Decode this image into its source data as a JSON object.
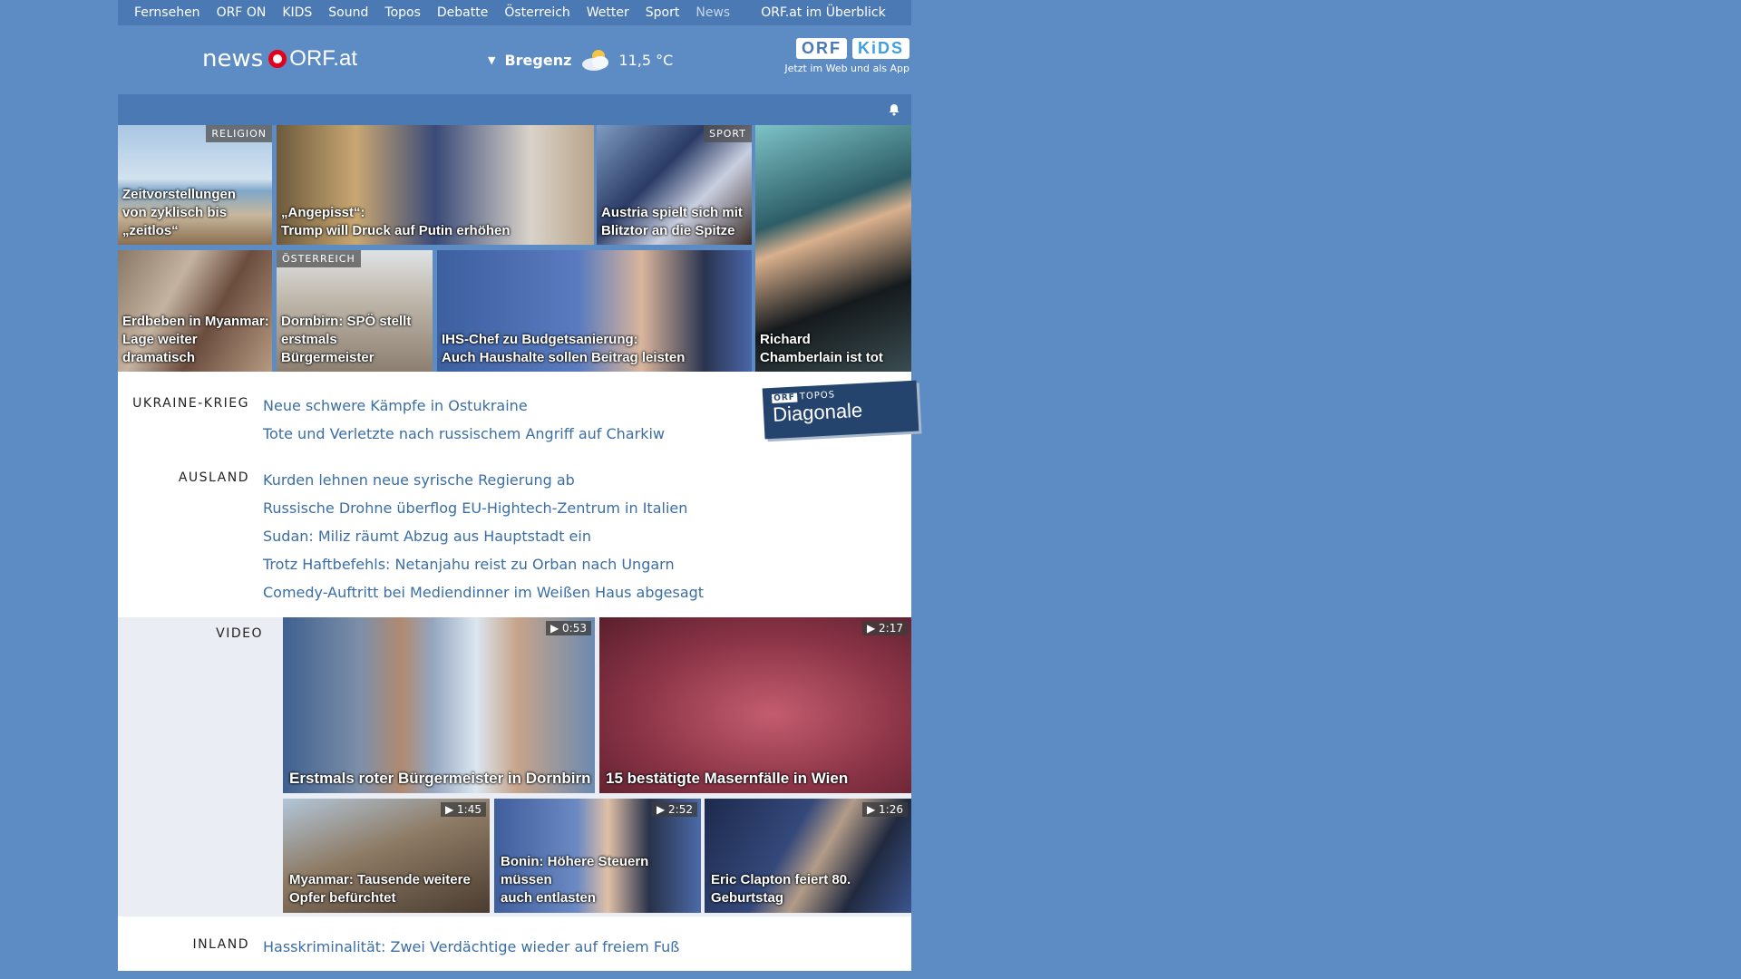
{
  "nav": {
    "items": [
      "Fernsehen",
      "ORF ON",
      "KIDS",
      "Sound",
      "Topos",
      "Debatte",
      "Österreich",
      "Wetter",
      "Sport",
      "News"
    ],
    "overview": "ORF.at im Überblick"
  },
  "header": {
    "logo_news": "news",
    "logo_orf": "ORF.at",
    "weather_city": "Bregenz",
    "weather_temp": "11,5 °C",
    "kids_orf": "ORF",
    "kids_kids": "KiDS",
    "kids_sub": "Jetzt im Web und als App"
  },
  "tiles": [
    {
      "tag": "RELIGION",
      "caption1": "Zeitvorstellungen",
      "caption2": "von zyklisch bis „zeitlos“"
    },
    {
      "tag": "",
      "caption1": "„Angepisst“:",
      "caption2": "Trump will Druck auf Putin erhöhen"
    },
    {
      "tag": "SPORT",
      "caption1": "Austria spielt sich mit",
      "caption2": "Blitztor an die Spitze"
    },
    {
      "tag": "",
      "caption1": "Richard",
      "caption2": "Chamberlain ist tot"
    },
    {
      "tag": "",
      "caption1": "Erdbeben in Myanmar:",
      "caption2": "Lage weiter dramatisch"
    },
    {
      "tag": "ÖSTERREICH",
      "caption1": "Dornbirn: SPÖ stellt",
      "caption2": "erstmals Bürgermeister"
    },
    {
      "tag": "",
      "caption1": "IHS-Chef zu Budgetsanierung:",
      "caption2": "Auch Haushalte sollen Beitrag leisten"
    }
  ],
  "sections": [
    {
      "label": "UKRAINE-KRIEG",
      "items": [
        "Neue schwere Kämpfe in Ostukraine",
        "Tote und Verletzte nach russischem Angriff auf Charkiw"
      ]
    },
    {
      "label": "AUSLAND",
      "items": [
        "Kurden lehnen neue syrische Regierung ab",
        "Russische Drohne überflog EU-Hightech-Zentrum in Italien",
        "Sudan: Miliz räumt Abzug aus Hauptstadt ein",
        "Trotz Haftbefehls: Netanjahu reist zu Orban nach Ungarn",
        "Comedy-Auftritt bei Mediendinner im Weißen Haus abgesagt"
      ]
    }
  ],
  "diagonale": {
    "orf": "ORF",
    "topos": "TOPOS",
    "title": "Diagonale"
  },
  "video": {
    "label": "VIDEO",
    "items": [
      {
        "duration": "0:53",
        "caption": "Erstmals roter Bürgermeister in Dornbirn"
      },
      {
        "duration": "2:17",
        "caption": "15 bestätigte Masernfälle in Wien"
      },
      {
        "duration": "1:45",
        "caption1": "Myanmar: Tausende weitere",
        "caption2": "Opfer befürchtet"
      },
      {
        "duration": "2:52",
        "caption1": "Bonin: Höhere Steuern müssen",
        "caption2": "auch entlasten"
      },
      {
        "duration": "1:26",
        "caption1": "Eric Clapton feiert 80.",
        "caption2": "Geburtstag"
      }
    ]
  },
  "inland": {
    "label": "INLAND",
    "items": [
      "Hasskriminalität: Zwei Verdächtige wieder auf freiem Fuß"
    ]
  }
}
